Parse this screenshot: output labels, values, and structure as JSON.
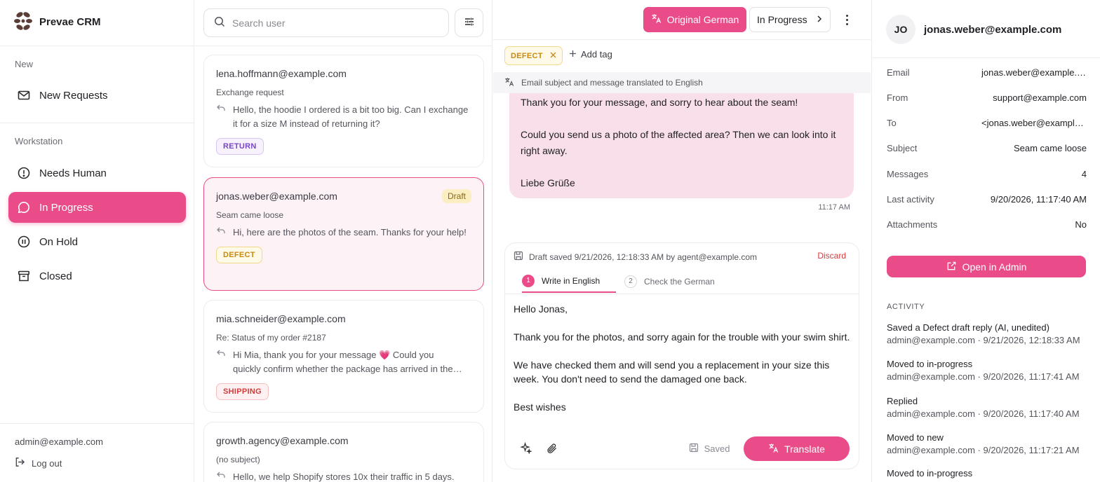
{
  "brand": {
    "name": "Prevae CRM"
  },
  "sidebar": {
    "section_new": "New",
    "new_requests": "New Requests",
    "section_workstation": "Workstation",
    "items": [
      {
        "label": "Needs Human",
        "icon": "alert-circle-icon"
      },
      {
        "label": "In Progress",
        "icon": "chat-bubble-icon",
        "active": true
      },
      {
        "label": "On Hold",
        "icon": "pause-circle-icon"
      },
      {
        "label": "Closed",
        "icon": "archive-icon"
      }
    ],
    "user_email": "admin@example.com",
    "logout": "Log out"
  },
  "list": {
    "search_placeholder": "Search user",
    "cards": [
      {
        "email": "lena.hoffmann@example.com",
        "subject": "Exchange request",
        "preview": "Hello, the hoodie I ordered is a bit too big. Can I exchange it for a size M instead of returning it?",
        "tag": "RETURN"
      },
      {
        "email": "jonas.weber@example.com",
        "subject": "Seam came loose",
        "preview": "Hi, here are the photos of the seam. Thanks for your help!",
        "tag": "DEFECT",
        "badge": "Draft"
      },
      {
        "email": "mia.schneider@example.com",
        "subject": "Re: Status of my order #2187",
        "preview_line1": "Hi Mia, thank you for your message 💗 Could you",
        "preview_line2": "quickly confirm whether the package has arrived in the…",
        "tag": "SHIPPING"
      },
      {
        "email": "growth.agency@example.com",
        "subject": "(no subject)",
        "preview": "Hello, we help Shopify stores 10x their traffic in 5 days."
      }
    ]
  },
  "thread": {
    "original_button": "Original German",
    "status_button": "In Progress",
    "tag": "DEFECT",
    "add_tag": "Add tag",
    "translation_note": "Email subject and message translated to English",
    "message": {
      "p1": "Thank you for your message, and sorry to hear about the seam!",
      "p2": "Could you send us a photo of the affected area? Then we can look into it right away.",
      "p3": "Liebe Grüße",
      "time": "11:17 AM"
    },
    "composer": {
      "draft_info": "Draft saved 9/21/2026, 12:18:33 AM by agent@example.com",
      "discard": "Discard",
      "step1_num": "1",
      "step1": "Write in English",
      "step2_num": "2",
      "step2": "Check the German",
      "body": "Hello Jonas,\n\nThank you for the photos, and sorry again for the trouble with your swim shirt.\n\nWe have checked them and will send you a replacement in your size this week. You don't need to send the damaged one back.\n\nBest wishes",
      "saved": "Saved",
      "translate": "Translate"
    }
  },
  "details": {
    "initials": "JO",
    "email": "jonas.weber@example.com",
    "fields": [
      {
        "k": "Email",
        "v": "jonas.weber@example.com"
      },
      {
        "k": "From",
        "v": "support@example.com"
      },
      {
        "k": "To",
        "v": "<jonas.weber@example.com>"
      },
      {
        "k": "Subject",
        "v": "Seam came loose"
      },
      {
        "k": "Messages",
        "v": "4"
      },
      {
        "k": "Last activity",
        "v": "9/20/2026, 11:17:40 AM"
      },
      {
        "k": "Attachments",
        "v": "No"
      }
    ],
    "open_admin": "Open in Admin",
    "activity_title": "ACTIVITY",
    "activity": [
      {
        "t": "Saved a Defect draft reply (AI, unedited)",
        "m": "admin@example.com · 9/21/2026, 12:18:33 AM"
      },
      {
        "t": "Moved to in-progress",
        "m": "admin@example.com · 9/20/2026, 11:17:41 AM"
      },
      {
        "t": "Replied",
        "m": "admin@example.com · 9/20/2026, 11:17:40 AM"
      },
      {
        "t": "Moved to new",
        "m": "admin@example.com · 9/20/2026, 11:17:21 AM"
      },
      {
        "t": "Moved to in-progress",
        "m": ""
      }
    ]
  },
  "colors": {
    "accent": "#ea4c89",
    "defect": "#c98a0e",
    "return": "#7b44c9",
    "shipping": "#d23b3b"
  }
}
